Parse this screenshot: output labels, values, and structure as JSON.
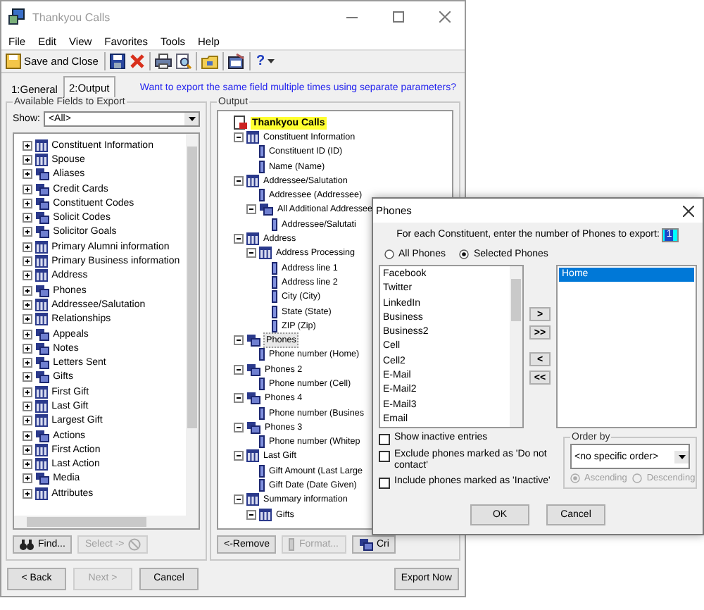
{
  "window": {
    "title": "Thankyou Calls"
  },
  "menu": [
    "File",
    "Edit",
    "View",
    "Favorites",
    "Tools",
    "Help"
  ],
  "toolbar": [
    {
      "kind": "save_close",
      "label": "Save and Close"
    },
    {
      "kind": "separator"
    },
    {
      "kind": "save"
    },
    {
      "kind": "delete"
    },
    {
      "kind": "separator"
    },
    {
      "kind": "print"
    },
    {
      "kind": "preview"
    },
    {
      "kind": "separator"
    },
    {
      "kind": "folder"
    },
    {
      "kind": "separator"
    },
    {
      "kind": "properties"
    },
    {
      "kind": "separator"
    },
    {
      "kind": "help",
      "label": "?"
    }
  ],
  "tabs": [
    {
      "label": "1:General",
      "selected": false
    },
    {
      "label": "2:Output",
      "selected": true
    }
  ],
  "link": "Want to export the same field multiple times using separate parameters?",
  "available": {
    "title": "Available Fields to Export",
    "show_label": "Show:",
    "show_value": "<All>",
    "items": [
      {
        "label": "Constituent Information",
        "kind": "table",
        "expanded": false
      },
      {
        "label": "Spouse",
        "kind": "table",
        "expanded": false
      },
      {
        "label": "Aliases",
        "kind": "multi",
        "expanded": false
      },
      {
        "label": "Credit Cards",
        "kind": "multi",
        "expanded": false
      },
      {
        "label": "Constituent Codes",
        "kind": "multi",
        "expanded": false
      },
      {
        "label": "Solicit Codes",
        "kind": "multi",
        "expanded": false
      },
      {
        "label": "Solicitor Goals",
        "kind": "multi",
        "expanded": false
      },
      {
        "label": "Primary Alumni information",
        "kind": "table",
        "expanded": false
      },
      {
        "label": "Primary Business information",
        "kind": "table",
        "expanded": false
      },
      {
        "label": "Address",
        "kind": "table",
        "expanded": false
      },
      {
        "label": "Phones",
        "kind": "multi",
        "expanded": false
      },
      {
        "label": "Addressee/Salutation",
        "kind": "table",
        "expanded": false
      },
      {
        "label": "Relationships",
        "kind": "table",
        "expanded": false
      },
      {
        "label": "Appeals",
        "kind": "multi",
        "expanded": false
      },
      {
        "label": "Notes",
        "kind": "multi",
        "expanded": false
      },
      {
        "label": "Letters Sent",
        "kind": "multi",
        "expanded": false
      },
      {
        "label": "Gifts",
        "kind": "multi",
        "expanded": false
      },
      {
        "label": "First Gift",
        "kind": "table",
        "expanded": false
      },
      {
        "label": "Last Gift",
        "kind": "table",
        "expanded": false
      },
      {
        "label": "Largest Gift",
        "kind": "table",
        "expanded": false
      },
      {
        "label": "Actions",
        "kind": "multi",
        "expanded": false
      },
      {
        "label": "First Action",
        "kind": "table",
        "expanded": false
      },
      {
        "label": "Last Action",
        "kind": "table",
        "expanded": false
      },
      {
        "label": "Media",
        "kind": "multi",
        "expanded": false
      },
      {
        "label": "Attributes",
        "kind": "table",
        "expanded": false
      }
    ],
    "buttons": [
      {
        "kind": "find",
        "label": "Find...",
        "disabled": false
      },
      {
        "kind": "select",
        "label": "Select ->",
        "disabled": true
      }
    ]
  },
  "output": {
    "title": "Output",
    "tree": [
      {
        "label": "Thankyou Calls",
        "kind": "root",
        "selected": false,
        "children": [
          {
            "label": "Constituent Information",
            "kind": "table",
            "selected": false,
            "expanded": true,
            "children": [
              {
                "label": "Constituent ID (ID)",
                "kind": "field",
                "selected": false
              },
              {
                "label": "Name (Name)",
                "kind": "field",
                "selected": false
              }
            ]
          },
          {
            "label": "Addressee/Salutation",
            "kind": "table",
            "selected": false,
            "expanded": true,
            "children": [
              {
                "label": "Addressee (Addressee)",
                "kind": "field",
                "selected": false
              },
              {
                "label": "All Additional Addressee",
                "kind": "multi",
                "selected": false,
                "expanded": true,
                "children": [
                  {
                    "label": "Addressee/Salutati",
                    "kind": "field",
                    "selected": false
                  }
                ]
              }
            ]
          },
          {
            "label": "Address",
            "kind": "table",
            "selected": false,
            "expanded": true,
            "children": [
              {
                "label": "Address Processing",
                "kind": "table",
                "selected": false,
                "expanded": true,
                "children": [
                  {
                    "label": "Address line 1",
                    "kind": "field",
                    "selected": false
                  },
                  {
                    "label": "Address line 2",
                    "kind": "field",
                    "selected": false
                  },
                  {
                    "label": "City (City)",
                    "kind": "field",
                    "selected": false
                  },
                  {
                    "label": "State (State)",
                    "kind": "field",
                    "selected": false
                  },
                  {
                    "label": "ZIP (Zip)",
                    "kind": "field",
                    "selected": false
                  }
                ]
              }
            ]
          },
          {
            "label": "Phones",
            "kind": "multi",
            "selected": true,
            "expanded": true,
            "children": [
              {
                "label": "Phone number (Home)",
                "kind": "field",
                "selected": false
              }
            ]
          },
          {
            "label": "Phones 2",
            "kind": "multi",
            "selected": false,
            "expanded": true,
            "children": [
              {
                "label": "Phone number (Cell)",
                "kind": "field",
                "selected": false
              }
            ]
          },
          {
            "label": "Phones 4",
            "kind": "multi",
            "selected": false,
            "expanded": true,
            "children": [
              {
                "label": "Phone number (Busines",
                "kind": "field",
                "selected": false
              }
            ]
          },
          {
            "label": "Phones 3",
            "kind": "multi",
            "selected": false,
            "expanded": true,
            "children": [
              {
                "label": "Phone number (Whitep",
                "kind": "field",
                "selected": false
              }
            ]
          },
          {
            "label": "Last Gift",
            "kind": "table",
            "selected": false,
            "expanded": true,
            "children": [
              {
                "label": "Gift Amount (Last Large",
                "kind": "field",
                "selected": false
              },
              {
                "label": "Gift Date (Date Given)",
                "kind": "field",
                "selected": false
              }
            ]
          },
          {
            "label": "Summary information",
            "kind": "table",
            "selected": false,
            "expanded": true,
            "children": [
              {
                "label": "Gifts",
                "kind": "table",
                "selected": false,
                "expanded": true
              }
            ]
          }
        ]
      }
    ],
    "buttons": [
      {
        "kind": "remove",
        "label": "<-Remove",
        "disabled": false
      },
      {
        "kind": "format",
        "label": "Format...",
        "disabled": true
      },
      {
        "kind": "criteria",
        "label": "Cri",
        "disabled": false
      }
    ]
  },
  "footer": {
    "buttons": [
      {
        "label": "< Back",
        "disabled": false
      },
      {
        "label": "Next >",
        "disabled": true
      },
      {
        "label": "Cancel",
        "disabled": false
      }
    ],
    "export": "Export Now"
  },
  "dialog": {
    "title": "Phones",
    "prompt": "For each Constituent, enter the number of Phones to export:",
    "count": "1",
    "scope": [
      {
        "label": "All Phones",
        "selected": false
      },
      {
        "label": "Selected Phones",
        "selected": true
      }
    ],
    "available": [
      "Facebook",
      "Twitter",
      "LinkedIn",
      "Business",
      "Business2",
      "Cell",
      "Cell2",
      "E-Mail",
      "E-Mail2",
      "E-Mail3",
      "Email"
    ],
    "move_buttons": [
      ">",
      ">>",
      "<",
      "<<"
    ],
    "chosen": [
      {
        "label": "Home",
        "selected": true
      }
    ],
    "options": [
      {
        "label": "Show inactive entries",
        "checked": false
      },
      {
        "label": "Exclude phones marked as 'Do not contact'",
        "checked": false
      },
      {
        "label": "Include phones marked as 'Inactive'",
        "checked": false
      }
    ],
    "order": {
      "title": "Order by",
      "value": "<no specific order>",
      "directions": [
        {
          "label": "Ascending",
          "selected": true,
          "disabled": true
        },
        {
          "label": "Descending",
          "selected": false,
          "disabled": true
        }
      ]
    },
    "buttons": [
      "OK",
      "Cancel"
    ]
  }
}
